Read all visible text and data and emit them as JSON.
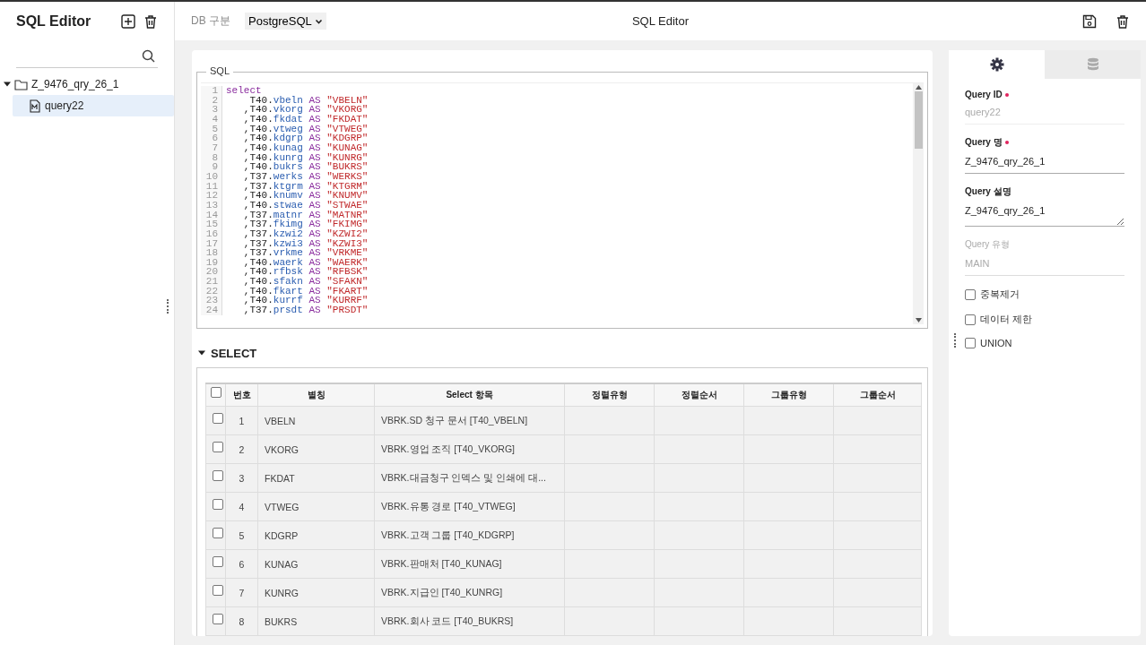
{
  "sidebar": {
    "title": "SQL Editor",
    "tree": [
      {
        "label": "Z_9476_qry_26_1",
        "expanded": true,
        "children": [
          {
            "label": "query22",
            "selected": true
          }
        ]
      }
    ]
  },
  "toolbar": {
    "db_label": "DB 구분",
    "db_select": {
      "value": "PostgreSQL"
    },
    "title": "SQL Editor"
  },
  "sql_panel": {
    "legend": "SQL",
    "lines": [
      {
        "num": "1",
        "keyword": "select"
      },
      {
        "num": "2",
        "table": "T40.",
        "column": "vbeln",
        "keyword": "AS",
        "alias": "\"VBELN\""
      },
      {
        "num": "3",
        "lead": "   ,",
        "table": "T40.",
        "column": "vkorg",
        "keyword": "AS",
        "alias": "\"VKORG\""
      },
      {
        "num": "4",
        "lead": "   ,",
        "table": "T40.",
        "column": "fkdat",
        "keyword": "AS",
        "alias": "\"FKDAT\""
      },
      {
        "num": "5",
        "lead": "   ,",
        "table": "T40.",
        "column": "vtweg",
        "keyword": "AS",
        "alias": "\"VTWEG\""
      },
      {
        "num": "6",
        "lead": "   ,",
        "table": "T40.",
        "column": "kdgrp",
        "keyword": "AS",
        "alias": "\"KDGRP\""
      },
      {
        "num": "7",
        "lead": "   ,",
        "table": "T40.",
        "column": "kunag",
        "keyword": "AS",
        "alias": "\"KUNAG\""
      },
      {
        "num": "8",
        "lead": "   ,",
        "table": "T40.",
        "column": "kunrg",
        "keyword": "AS",
        "alias": "\"KUNRG\""
      },
      {
        "num": "9",
        "lead": "   ,",
        "table": "T40.",
        "column": "bukrs",
        "keyword": "AS",
        "alias": "\"BUKRS\""
      },
      {
        "num": "10",
        "lead": "   ,",
        "table": "T37.",
        "column": "werks",
        "keyword": "AS",
        "alias": "\"WERKS\""
      },
      {
        "num": "11",
        "lead": "   ,",
        "table": "T37.",
        "column": "ktgrm",
        "keyword": "AS",
        "alias": "\"KTGRM\""
      },
      {
        "num": "12",
        "lead": "   ,",
        "table": "T40.",
        "column": "knumv",
        "keyword": "AS",
        "alias": "\"KNUMV\""
      },
      {
        "num": "13",
        "lead": "   ,",
        "table": "T40.",
        "column": "stwae",
        "keyword": "AS",
        "alias": "\"STWAE\""
      },
      {
        "num": "14",
        "lead": "   ,",
        "table": "T37.",
        "column": "matnr",
        "keyword": "AS",
        "alias": "\"MATNR\""
      },
      {
        "num": "15",
        "lead": "   ,",
        "table": "T37.",
        "column": "fkimg",
        "keyword": "AS",
        "alias": "\"FKIMG\""
      },
      {
        "num": "16",
        "lead": "   ,",
        "table": "T37.",
        "column": "kzwi2",
        "keyword": "AS",
        "alias": "\"KZWI2\""
      },
      {
        "num": "17",
        "lead": "   ,",
        "table": "T37.",
        "column": "kzwi3",
        "keyword": "AS",
        "alias": "\"KZWI3\""
      },
      {
        "num": "18",
        "lead": "   ,",
        "table": "T37.",
        "column": "vrkme",
        "keyword": "AS",
        "alias": "\"VRKME\""
      },
      {
        "num": "19",
        "lead": "   ,",
        "table": "T40.",
        "column": "waerk",
        "keyword": "AS",
        "alias": "\"WAERK\""
      },
      {
        "num": "20",
        "lead": "   ,",
        "table": "T40.",
        "column": "rfbsk",
        "keyword": "AS",
        "alias": "\"RFBSK\""
      },
      {
        "num": "21",
        "lead": "   ,",
        "table": "T40.",
        "column": "sfakn",
        "keyword": "AS",
        "alias": "\"SFAKN\""
      },
      {
        "num": "22",
        "lead": "   ,",
        "table": "T40.",
        "column": "fkart",
        "keyword": "AS",
        "alias": "\"FKART\""
      },
      {
        "num": "23",
        "lead": "   ,",
        "table": "T40.",
        "column": "kurrf",
        "keyword": "AS",
        "alias": "\"KURRF\""
      },
      {
        "num": "24",
        "lead": "   ,",
        "table": "T37.",
        "column": "prsdt",
        "keyword": "AS",
        "alias": "\"PRSDT\""
      }
    ]
  },
  "select_section": {
    "title": "SELECT",
    "expanded": true,
    "table": {
      "all_checked": false,
      "columns": [
        "번호",
        "별칭",
        "Select 항목",
        "정렬유형",
        "정렬순서",
        "그룹유형",
        "그룹순서"
      ],
      "rows": [
        {
          "checked": false,
          "cells": [
            "1",
            "VBELN",
            "VBRK.SD 청구 문서 [T40_VBELN]"
          ]
        },
        {
          "checked": false,
          "cells": [
            "2",
            "VKORG",
            "VBRK.영업 조직 [T40_VKORG]"
          ]
        },
        {
          "checked": false,
          "cells": [
            "3",
            "FKDAT",
            "VBRK.대금청구 인덱스 및 인쇄에 대..."
          ]
        },
        {
          "checked": false,
          "cells": [
            "4",
            "VTWEG",
            "VBRK.유통 경로 [T40_VTWEG]"
          ]
        },
        {
          "checked": false,
          "cells": [
            "5",
            "KDGRP",
            "VBRK.고객 그룹 [T40_KDGRP]"
          ]
        },
        {
          "checked": false,
          "cells": [
            "6",
            "KUNAG",
            "VBRK.판매처 [T40_KUNAG]"
          ]
        },
        {
          "checked": false,
          "cells": [
            "7",
            "KUNRG",
            "VBRK.지급인 [T40_KUNRG]"
          ]
        },
        {
          "checked": false,
          "cells": [
            "8",
            "BUKRS",
            "VBRK.회사 코드 [T40_BUKRS]"
          ]
        }
      ]
    }
  },
  "properties": {
    "tabs": [
      {
        "kind": "settings",
        "selected": true
      },
      {
        "kind": "database",
        "selected": false
      }
    ],
    "fields": [
      {
        "kind": "input",
        "label": "Query ID",
        "required": true,
        "value": "query22",
        "readonly": true,
        "disabled": false
      },
      {
        "kind": "input",
        "label": "Query 명",
        "required": true,
        "value": "Z_9476_qry_26_1",
        "readonly": false,
        "disabled": false
      },
      {
        "kind": "textarea",
        "label": "Query 설명",
        "required": false,
        "value": "Z_9476_qry_26_1",
        "readonly": false,
        "disabled": false
      },
      {
        "kind": "input",
        "label": "Query 유형",
        "required": false,
        "value": "MAIN",
        "readonly": false,
        "disabled": true
      }
    ],
    "checkboxes": [
      {
        "label": "중복제거",
        "checked": false
      },
      {
        "label": "데이터 제한",
        "checked": false
      },
      {
        "label": "UNION",
        "checked": false
      }
    ]
  }
}
